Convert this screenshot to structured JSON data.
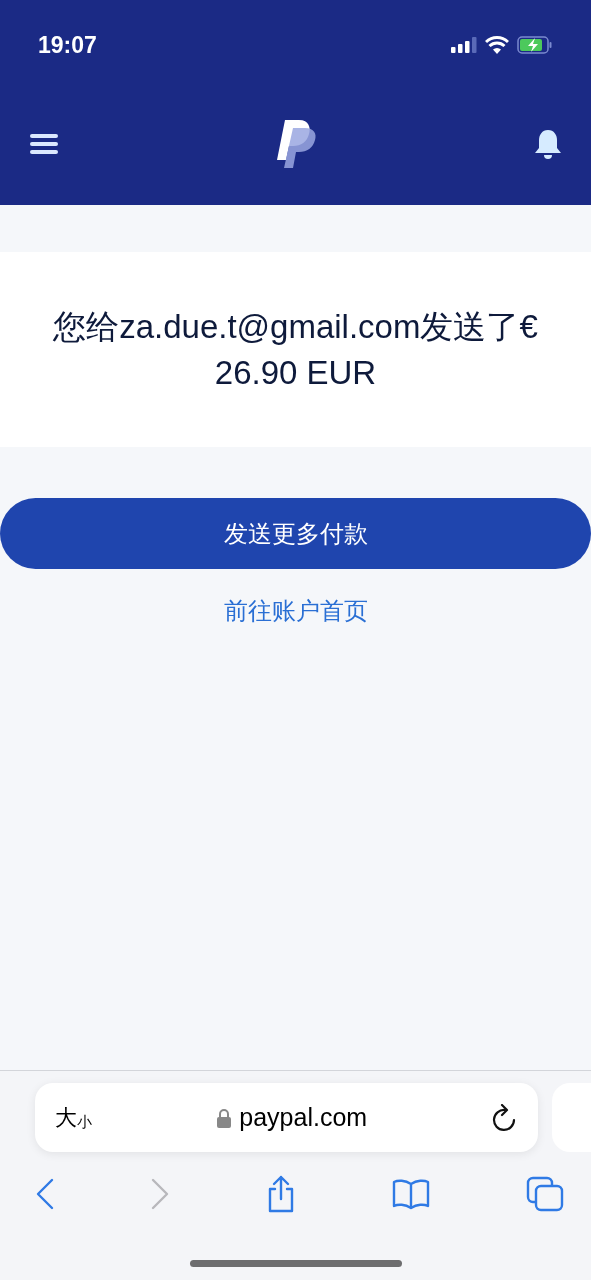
{
  "status_bar": {
    "time": "19:07"
  },
  "message": "您给za.due.t@gmail.com发送了€ 26.90 EUR",
  "primary_button": "发送更多付款",
  "link": "前往账户首页",
  "browser": {
    "text_size_large": "大",
    "text_size_small": "小",
    "url": "paypal.com"
  },
  "toolbar": [
    {
      "kind": "back",
      "disabled": false
    },
    {
      "kind": "forward",
      "disabled": true
    },
    {
      "kind": "share",
      "disabled": false
    },
    {
      "kind": "bookmarks",
      "disabled": false
    },
    {
      "kind": "tabs",
      "disabled": false
    }
  ]
}
